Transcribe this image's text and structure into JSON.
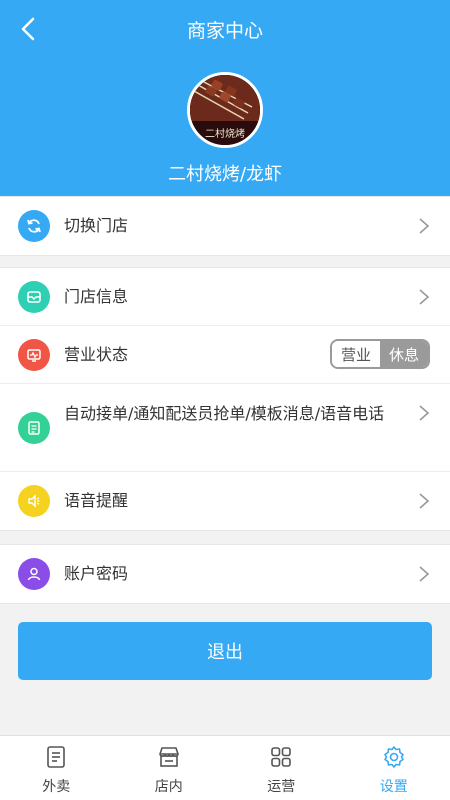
{
  "header": {
    "title": "商家中心",
    "store_name": "二村烧烤/龙虾",
    "avatar_caption": "二村烧烤"
  },
  "menu": {
    "switch_store": "切换门店",
    "store_info": "门店信息",
    "business_status": "营业状态",
    "status_open": "营业",
    "status_closed": "休息",
    "auto_order": "自动接单/通知配送员抢单/模板消息/语音电话",
    "voice_reminder": "语音提醒",
    "account_password": "账户密码"
  },
  "logout_label": "退出",
  "tabs": [
    {
      "label": "外卖"
    },
    {
      "label": "店内"
    },
    {
      "label": "运营"
    },
    {
      "label": "设置"
    }
  ],
  "colors": {
    "primary": "#36a9f4",
    "icon_switch": "#36a9f4",
    "icon_info": "#2ecfb3",
    "icon_status": "#f05545",
    "icon_auto": "#33d196",
    "icon_voice": "#f4d21f",
    "icon_account": "#8a4de8"
  }
}
